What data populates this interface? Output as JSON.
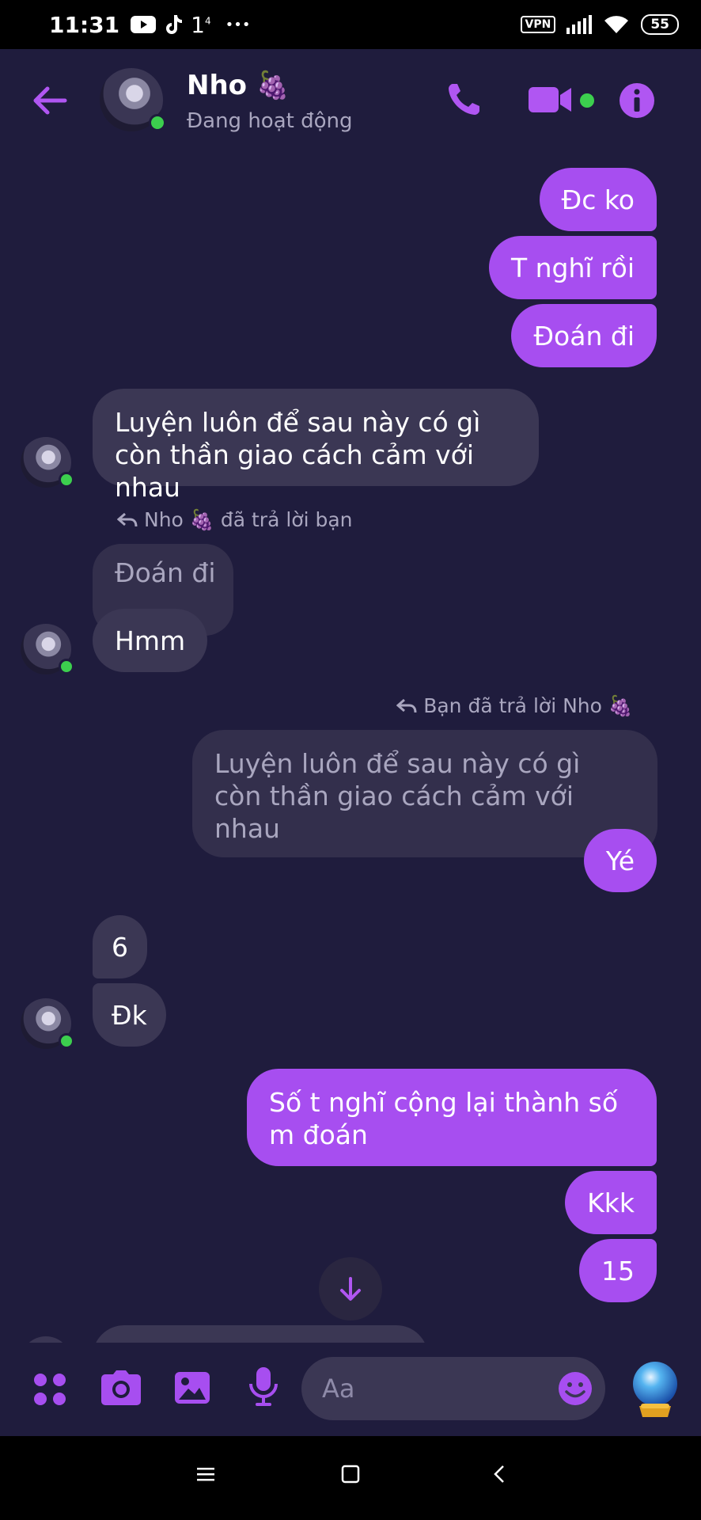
{
  "status_bar": {
    "time": "11:31",
    "extra": "1",
    "extra_sup": "4",
    "dots": "•••",
    "vpn": "VPN",
    "battery": "55"
  },
  "header": {
    "contact_name": "Nho 🍇",
    "contact_status": "Đang hoạt động"
  },
  "messages": [
    {
      "dir": "out",
      "text": "Đc ko"
    },
    {
      "dir": "out",
      "text": "T nghĩ rồi"
    },
    {
      "dir": "out",
      "text": "Đoán đi"
    },
    {
      "dir": "in",
      "text": "Luyện luôn để sau này có gì còn thần giao cách cảm với nhau"
    },
    {
      "dir": "reply_label_in",
      "text": "Nho 🍇 đã trả lời bạn"
    },
    {
      "dir": "quoted_in",
      "text": "Đoán đi"
    },
    {
      "dir": "in",
      "text": "Hmm"
    },
    {
      "dir": "reply_label_out",
      "text": "Bạn đã trả lời Nho 🍇"
    },
    {
      "dir": "quoted_out",
      "text": "Luyện luôn để sau này có gì còn thần giao cách cảm với nhau"
    },
    {
      "dir": "out",
      "text": "Yé"
    },
    {
      "dir": "in",
      "text": "6"
    },
    {
      "dir": "in",
      "text": "Đk"
    },
    {
      "dir": "out",
      "text": "Số t nghĩ cộng lại thành số m đoán"
    },
    {
      "dir": "out",
      "text": "Kkk"
    },
    {
      "dir": "out",
      "text": "15"
    }
  ],
  "composer": {
    "placeholder": "Aa"
  },
  "icons": {
    "accent": "#a74ef0",
    "online": "#3ccf4e"
  }
}
